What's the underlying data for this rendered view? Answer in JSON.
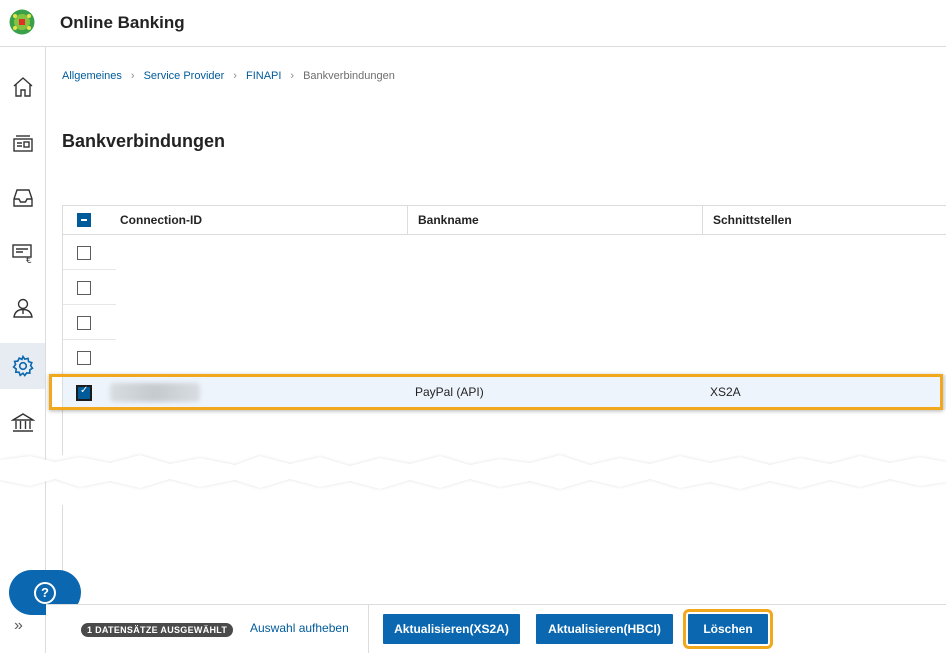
{
  "header": {
    "title": "Online Banking"
  },
  "nav": {
    "items": [
      {
        "icon": "home-icon"
      },
      {
        "icon": "cards-icon"
      },
      {
        "icon": "inbox-icon"
      },
      {
        "icon": "payments-icon"
      },
      {
        "icon": "user-icon"
      },
      {
        "icon": "settings-icon"
      },
      {
        "icon": "bank-icon"
      }
    ],
    "active_index": 5
  },
  "breadcrumb": {
    "items": [
      "Allgemeines",
      "Service Provider",
      "FINAPI"
    ],
    "current": "Bankverbindungen"
  },
  "page": {
    "title": "Bankverbindungen"
  },
  "table": {
    "columns": [
      "Connection-ID",
      "Bankname",
      "Schnittstellen"
    ],
    "rows": [
      {
        "checked": false,
        "connection_id": "",
        "bankname": "",
        "interface": ""
      },
      {
        "checked": false,
        "connection_id": "",
        "bankname": "",
        "interface": ""
      },
      {
        "checked": false,
        "connection_id": "",
        "bankname": "",
        "interface": ""
      },
      {
        "checked": false,
        "connection_id": "",
        "bankname": "",
        "interface": ""
      },
      {
        "checked": true,
        "connection_id": "",
        "bankname": "PayPal (API)",
        "interface": "XS2A"
      }
    ]
  },
  "footer": {
    "selected_badge": "1 DATENSÄTZE AUSGEWÄHLT",
    "clear_selection": "Auswahl aufheben",
    "btn_update_xs2a": "Aktualisieren(XS2A)",
    "btn_update_hbci": "Aktualisieren(HBCI)",
    "btn_delete": "Löschen"
  },
  "colors": {
    "primary": "#0a67b0",
    "highlight": "#f2a81d",
    "link": "#005b9a"
  }
}
